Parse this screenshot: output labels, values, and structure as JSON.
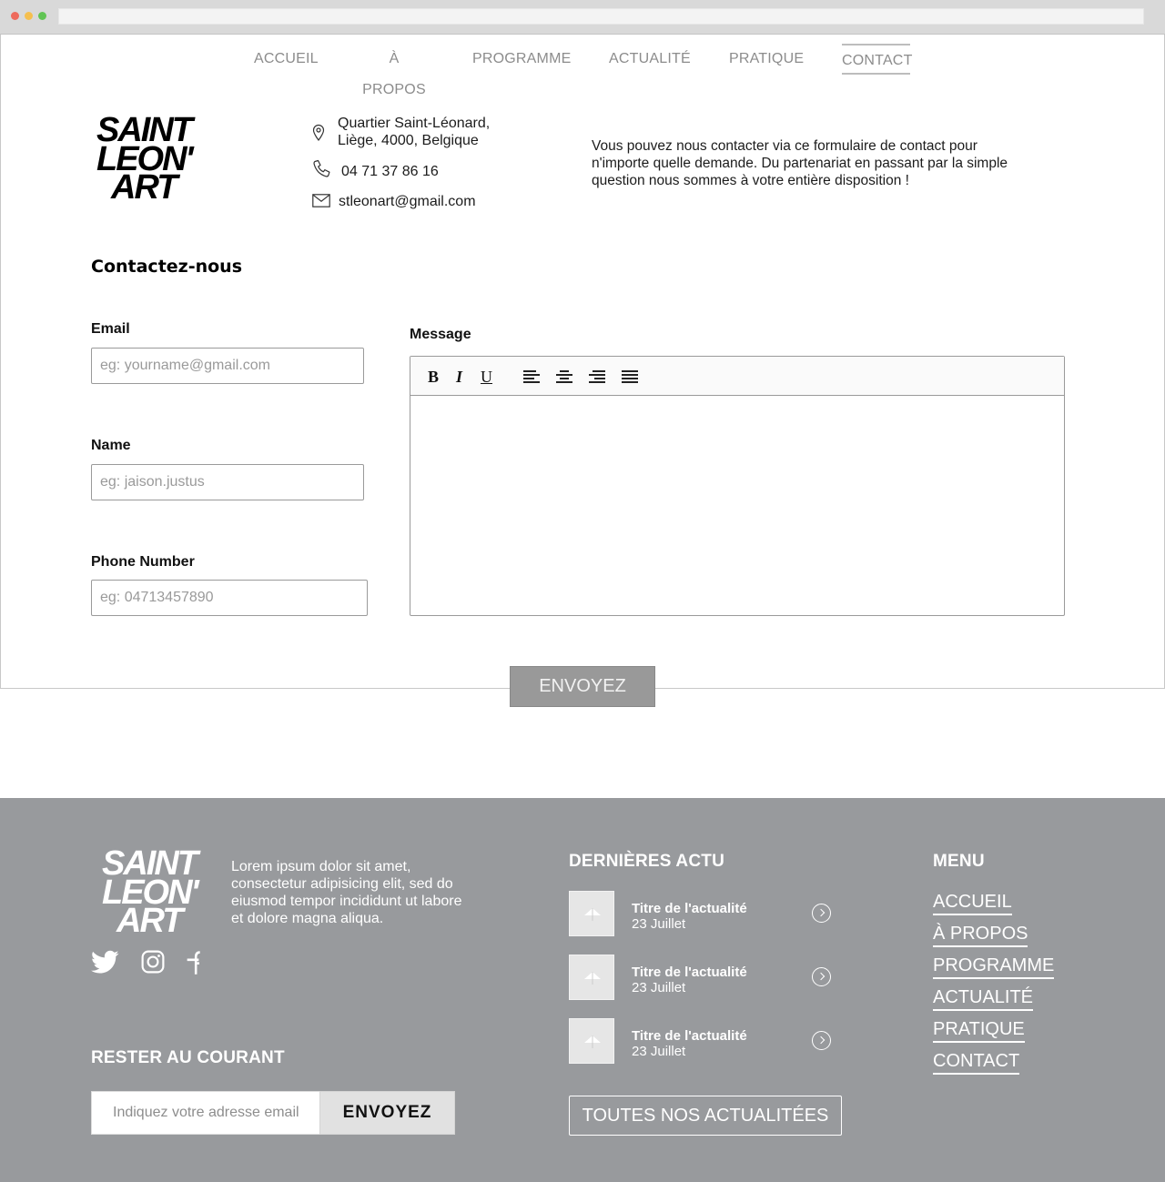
{
  "nav": {
    "items": [
      "ACCUEIL",
      "À PROPOS",
      "PROGRAMME",
      "ACTUALITÉ",
      "PRATIQUE",
      "CONTACT"
    ],
    "active": "CONTACT"
  },
  "logo": {
    "line1": "SAINT",
    "line2": "LEON'",
    "line3": "ART"
  },
  "contact": {
    "address_line1": "Quartier Saint-Léonard,",
    "address_line2": "Liège, 4000, Belgique",
    "phone": "04 71 37 86 16",
    "email": "stleonart@gmail.com"
  },
  "intro": "Vous pouvez nous contacter via ce formulaire de contact pour n'importe quelle demande. Du partenariat en passant par la simple question nous sommes à votre entière disposition !",
  "form": {
    "title": "Contactez-nous",
    "email_label": "Email",
    "email_placeholder": "eg: yourname@gmail.com",
    "name_label": "Name",
    "name_placeholder": "eg: jaison.justus",
    "phone_label": "Phone Number",
    "phone_placeholder": "eg: 04713457890",
    "message_label": "Message",
    "toolbar": {
      "bold": "B",
      "italic": "I",
      "underline": "U"
    },
    "submit": "ENVOYEZ"
  },
  "footer": {
    "description": "Lorem ipsum dolor sit amet, consectetur adipisicing elit, sed do eiusmod tempor incididunt ut labore et dolore magna aliqua.",
    "newsletter_title": "RESTER AU COURANT",
    "newsletter_placeholder": "Indiquez votre adresse email",
    "newsletter_button": "ENVOYEZ",
    "news_title": "DERNIÈRES ACTU",
    "news": [
      {
        "title": "Titre de l'actualité",
        "date": "23 Juillet"
      },
      {
        "title": "Titre de l'actualité",
        "date": "23 Juillet"
      },
      {
        "title": "Titre de l'actualité",
        "date": "23 Juillet"
      }
    ],
    "all_news": "TOUTES NOS ACTUALITÉES",
    "menu_title": "MENU",
    "menu": [
      "ACCUEIL",
      "À PROPOS",
      "PROGRAMME",
      "ACTUALITÉ",
      "PRATIQUE",
      "CONTACT"
    ]
  },
  "icons": {
    "social": [
      "twitter-icon",
      "instagram-icon",
      "facebook-icon"
    ],
    "contact": [
      "map-pin-icon",
      "phone-icon",
      "mail-icon"
    ]
  }
}
